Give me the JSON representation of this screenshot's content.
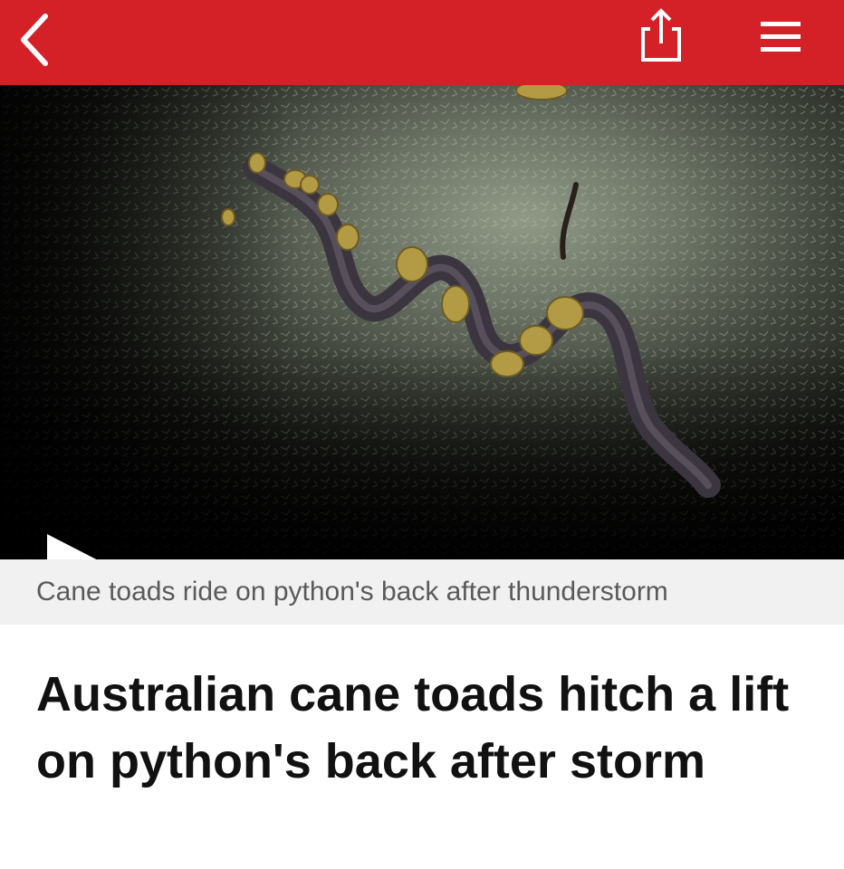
{
  "topbar": {
    "background_color": "#d42027",
    "back_icon": "chevron-left-icon",
    "share_icon": "share-icon",
    "menu_icon": "hamburger-menu-icon"
  },
  "video": {
    "play_icon": "play-icon"
  },
  "caption": {
    "text": "Cane toads ride on python's back after thunderstorm"
  },
  "article": {
    "headline": "Australian cane toads hitch a lift on python's back after storm"
  }
}
